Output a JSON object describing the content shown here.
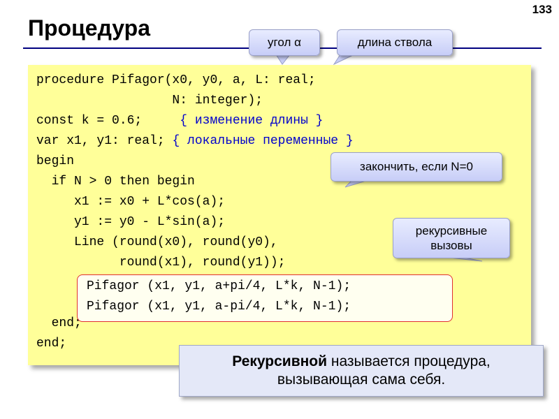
{
  "slide": {
    "number": "133",
    "title": "Процедура"
  },
  "callouts": {
    "angle": "угол α",
    "length": "длина ствола",
    "stop": "закончить, если N=0",
    "recursive_line1": "рекурсивные",
    "recursive_line2": "вызовы"
  },
  "code": {
    "lines": [
      "procedure Pifagor(x0, y0, a, L: real;",
      "                  N: integer);",
      "const k = 0.6;",
      "var x1, y1: real;",
      "begin",
      "  if N > 0 then begin",
      "     x1 := x0 + L*cos(a);",
      "     y1 := y0 - L*sin(a);",
      "     Line (round(x0), round(y0),",
      "           round(x1), round(y1));"
    ],
    "comment_k": "{ изменение длины }",
    "comment_vars": "{ локальные переменные }",
    "recursive_calls": [
      "Pifagor (x1, y1, a+pi/4, L*k, N-1);",
      "Pifagor (x1, y1, a-pi/4, L*k, N-1);"
    ],
    "tail": [
      "  end;",
      "end;"
    ]
  },
  "definition": {
    "bold": "Рекурсивной",
    "rest": " называется процедура,",
    "line2": "вызывающая сама себя."
  },
  "colors": {
    "code_background": "#ffff99",
    "comment": "#0000cc",
    "title_rule": "#000080",
    "recursion_border": "#e03030",
    "callout": "#c7cdf7"
  }
}
